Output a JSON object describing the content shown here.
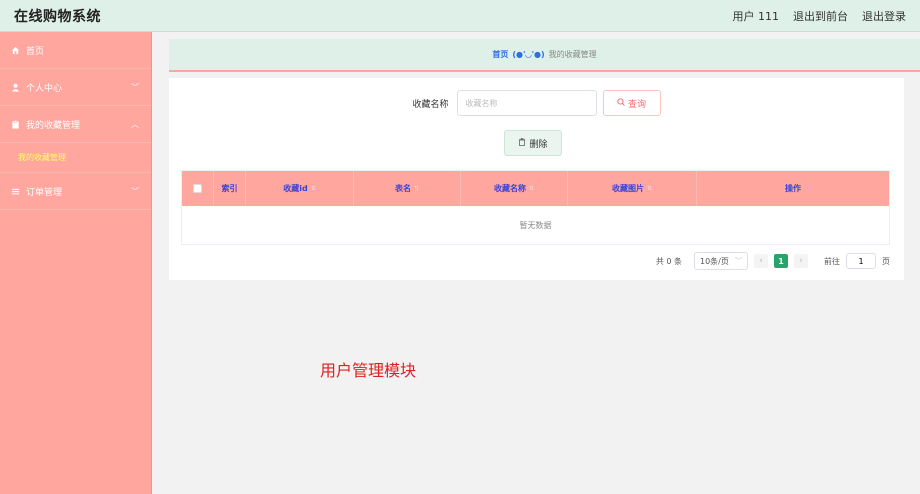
{
  "header": {
    "title": "在线购物系统",
    "user_label": "用户 111",
    "back_front_label": "退出到前台",
    "logout_label": "退出登录"
  },
  "sidebar": {
    "items": [
      {
        "label": "首页",
        "icon": "home-icon"
      },
      {
        "label": "个人中心",
        "icon": "user-icon"
      },
      {
        "label": "我的收藏管理",
        "icon": "clipboard-icon"
      },
      {
        "label": "订单管理",
        "icon": "list-icon"
      }
    ],
    "active_sub_item": "我的收藏管理"
  },
  "breadcrumb": {
    "home": "首页",
    "face": "(●'◡'●)",
    "current": "我的收藏管理"
  },
  "search": {
    "label": "收藏名称",
    "placeholder": "收藏名称",
    "button_label": "查询"
  },
  "actions": {
    "delete_label": "删除"
  },
  "table": {
    "columns": [
      "索引",
      "收藏id",
      "表名",
      "收藏名称",
      "收藏图片",
      "操作"
    ],
    "empty_text": "暂无数据"
  },
  "pagination": {
    "total_text": "共 0 条",
    "page_size": "10条/页",
    "current_page": "1",
    "goto_prefix": "前往",
    "goto_value": "1",
    "goto_suffix": "页"
  },
  "annotation": "用户管理模块",
  "colors": {
    "sidebar_bg": "#ffa69e",
    "topbar_bg": "#dff0e8",
    "submenu_active": "#ffff66",
    "table_header_text": "#3a43d8",
    "page_active": "#27a36b",
    "annotation": "#e02020"
  }
}
